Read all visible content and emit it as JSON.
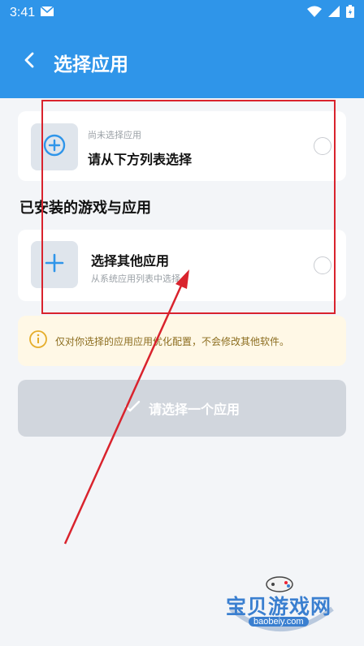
{
  "status_bar": {
    "time": "3:41"
  },
  "header": {
    "title": "选择应用"
  },
  "selected_app": {
    "sub_label": "尚未选择应用",
    "main_label": "请从下方列表选择"
  },
  "installed_section": {
    "title": "已安装的游戏与应用"
  },
  "other_app": {
    "main_label": "选择其他应用",
    "sub_label": "从系统应用列表中选择"
  },
  "notice": {
    "text": "仅对你选择的应用应用优化配置，不会修改其他软件。"
  },
  "confirm_button": {
    "label": "请选择一个应用"
  },
  "watermark": {
    "text": "宝贝游戏网",
    "url": "baobeiy.com"
  },
  "colors": {
    "header_bg": "#2f95e9",
    "accent": "#2f95e9",
    "annotation_red": "#d9232d",
    "notice_bg": "#fff8e6",
    "disabled_button": "#d1d6dd"
  },
  "icons": [
    "mail-icon",
    "wifi-icon",
    "signal-icon",
    "battery-icon",
    "back-arrow-icon",
    "add-circle-icon",
    "plus-icon",
    "info-icon",
    "check-icon"
  ]
}
